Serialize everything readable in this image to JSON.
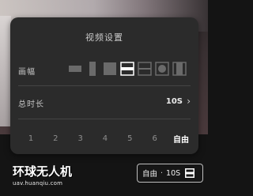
{
  "dialog": {
    "title": "视频设置",
    "aspect_ratio": {
      "label": "画幅",
      "options": [
        {
          "icon": "ratio-wide-icon"
        },
        {
          "icon": "ratio-portrait-icon"
        },
        {
          "icon": "ratio-square-icon"
        },
        {
          "icon": "ratio-letterbox-icon",
          "selected": true
        },
        {
          "icon": "ratio-split-icon"
        },
        {
          "icon": "ratio-circle-icon"
        },
        {
          "icon": "ratio-bars-icon"
        }
      ]
    },
    "duration": {
      "label": "总时长",
      "value": "10S",
      "chevron": "›"
    },
    "number_options": [
      "1",
      "2",
      "3",
      "4",
      "5",
      "6",
      "自由"
    ],
    "selected_number": "自由"
  },
  "watermark": {
    "logo_text": "环球无人机",
    "url": "uav.huanqiu.com"
  },
  "status_pill": {
    "mode": "自由",
    "separator": "·",
    "duration": "10S",
    "icon": "ratio-letterbox-icon"
  },
  "colors": {
    "dialog_bg": "#2b2b2b",
    "text_primary": "#eaeaea",
    "text_muted": "#8e8e8e",
    "selected": "#ffffff"
  }
}
